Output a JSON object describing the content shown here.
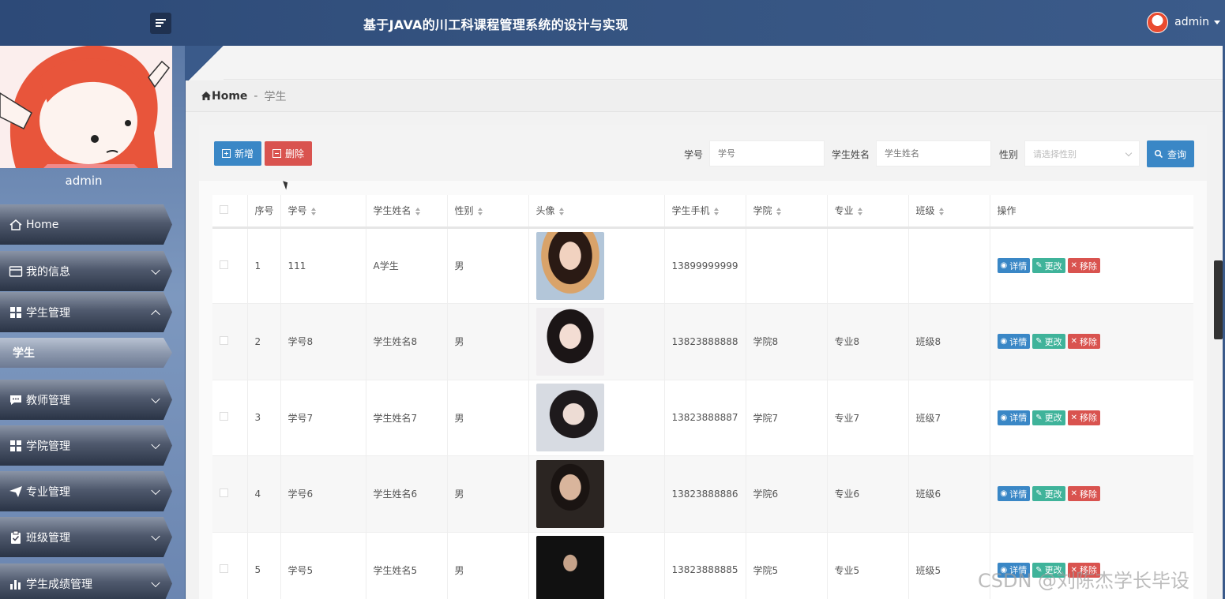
{
  "header": {
    "title": "基于JAVA的川工科课程管理系统的设计与实现",
    "username": "admin"
  },
  "sidebar": {
    "profile_name": "admin",
    "items": [
      {
        "label": "Home",
        "icon": "home-icon"
      },
      {
        "label": "我的信息",
        "icon": "card-icon"
      },
      {
        "label": "学生管理",
        "icon": "grid-icon"
      },
      {
        "label": "学生",
        "icon": ""
      },
      {
        "label": "教师管理",
        "icon": "chat-icon"
      },
      {
        "label": "学院管理",
        "icon": "grid-icon"
      },
      {
        "label": "专业管理",
        "icon": "send-icon"
      },
      {
        "label": "班级管理",
        "icon": "clipboard-icon"
      },
      {
        "label": "学生成绩管理",
        "icon": "bar-chart-icon"
      }
    ]
  },
  "breadcrumb": {
    "home": "Home",
    "separator": "-",
    "current": "学生"
  },
  "toolbar": {
    "add_label": "新增",
    "delete_label": "删除",
    "student_no_label": "学号",
    "student_no_placeholder": "学号",
    "student_name_label": "学生姓名",
    "student_name_placeholder": "学生姓名",
    "gender_label": "性别",
    "gender_placeholder": "请选择性别",
    "query_label": "查询"
  },
  "table": {
    "headers": [
      "序号",
      "学号",
      "学生姓名",
      "性别",
      "头像",
      "学生手机",
      "学院",
      "专业",
      "班级",
      "操作"
    ],
    "rows": [
      {
        "index": "1",
        "no": "111",
        "name": "A学生",
        "gender": "男",
        "phone": "13899999999",
        "college": "",
        "major": "",
        "class": ""
      },
      {
        "index": "2",
        "no": "学号8",
        "name": "学生姓名8",
        "gender": "男",
        "phone": "13823888888",
        "college": "学院8",
        "major": "专业8",
        "class": "班级8"
      },
      {
        "index": "3",
        "no": "学号7",
        "name": "学生姓名7",
        "gender": "男",
        "phone": "13823888887",
        "college": "学院7",
        "major": "专业7",
        "class": "班级7"
      },
      {
        "index": "4",
        "no": "学号6",
        "name": "学生姓名6",
        "gender": "男",
        "phone": "13823888886",
        "college": "学院6",
        "major": "专业6",
        "class": "班级6"
      },
      {
        "index": "5",
        "no": "学号5",
        "name": "学生姓名5",
        "gender": "男",
        "phone": "13823888885",
        "college": "学院5",
        "major": "专业5",
        "class": "班级5"
      }
    ],
    "actions": {
      "detail": "详情",
      "edit": "更改",
      "remove": "移除"
    }
  },
  "watermark": "CSDN @刘陈杰学长毕设",
  "colors": {
    "primary": "#3a87c6",
    "danger": "#d9534f",
    "success": "#3fb39a",
    "header": "#2d4a78"
  }
}
